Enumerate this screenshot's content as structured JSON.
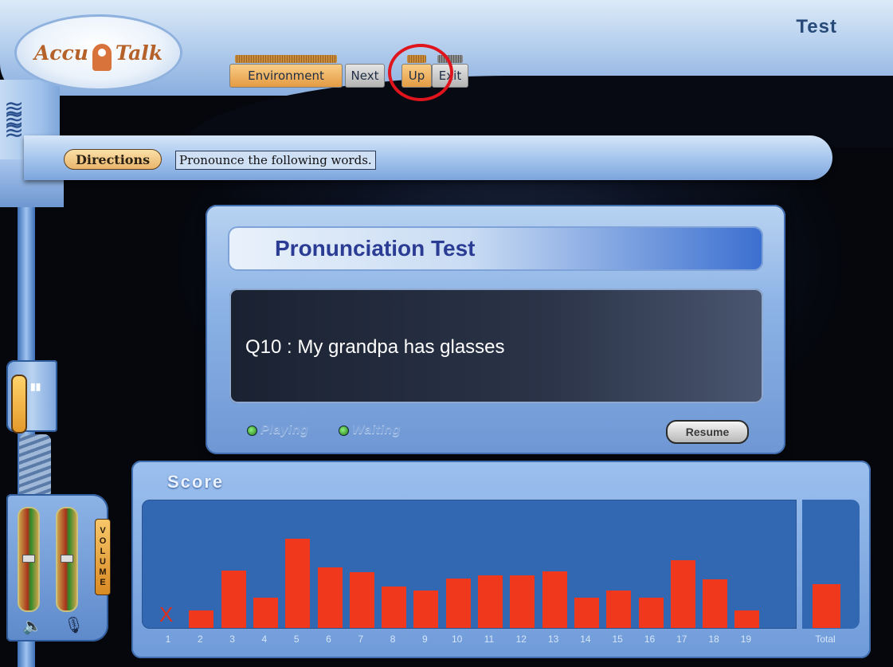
{
  "app": {
    "logo_left": "Accu",
    "logo_right": "Talk",
    "mode": "Test"
  },
  "nav": {
    "environment": "Environment",
    "next": "Next",
    "up": "Up",
    "exit": "Exit"
  },
  "directions": {
    "label": "Directions",
    "text": "Pronounce the following words."
  },
  "panel": {
    "title": "Pronunciation Test",
    "question": "Q10 : My grandpa has glasses",
    "status_playing": "Playing",
    "status_waiting": "Waiting",
    "resume": "Resume"
  },
  "volume": {
    "label": "VOLUME"
  },
  "score": {
    "title": "Score",
    "total_label": "Total",
    "x_mark": "X"
  },
  "chart_data": {
    "type": "bar",
    "categories": [
      "1",
      "2",
      "3",
      "4",
      "5",
      "6",
      "7",
      "8",
      "9",
      "10",
      "11",
      "12",
      "13",
      "14",
      "15",
      "16",
      "17",
      "18",
      "19"
    ],
    "values": [
      0,
      22,
      72,
      38,
      112,
      76,
      70,
      52,
      47,
      62,
      66,
      66,
      71,
      38,
      47,
      38,
      85,
      61,
      22
    ],
    "total": 55,
    "bar_color": "#f0381c"
  },
  "colors": {
    "accent_red": "#e0141c",
    "panel_blue": "#3267b2",
    "bar": "#f0381c"
  }
}
